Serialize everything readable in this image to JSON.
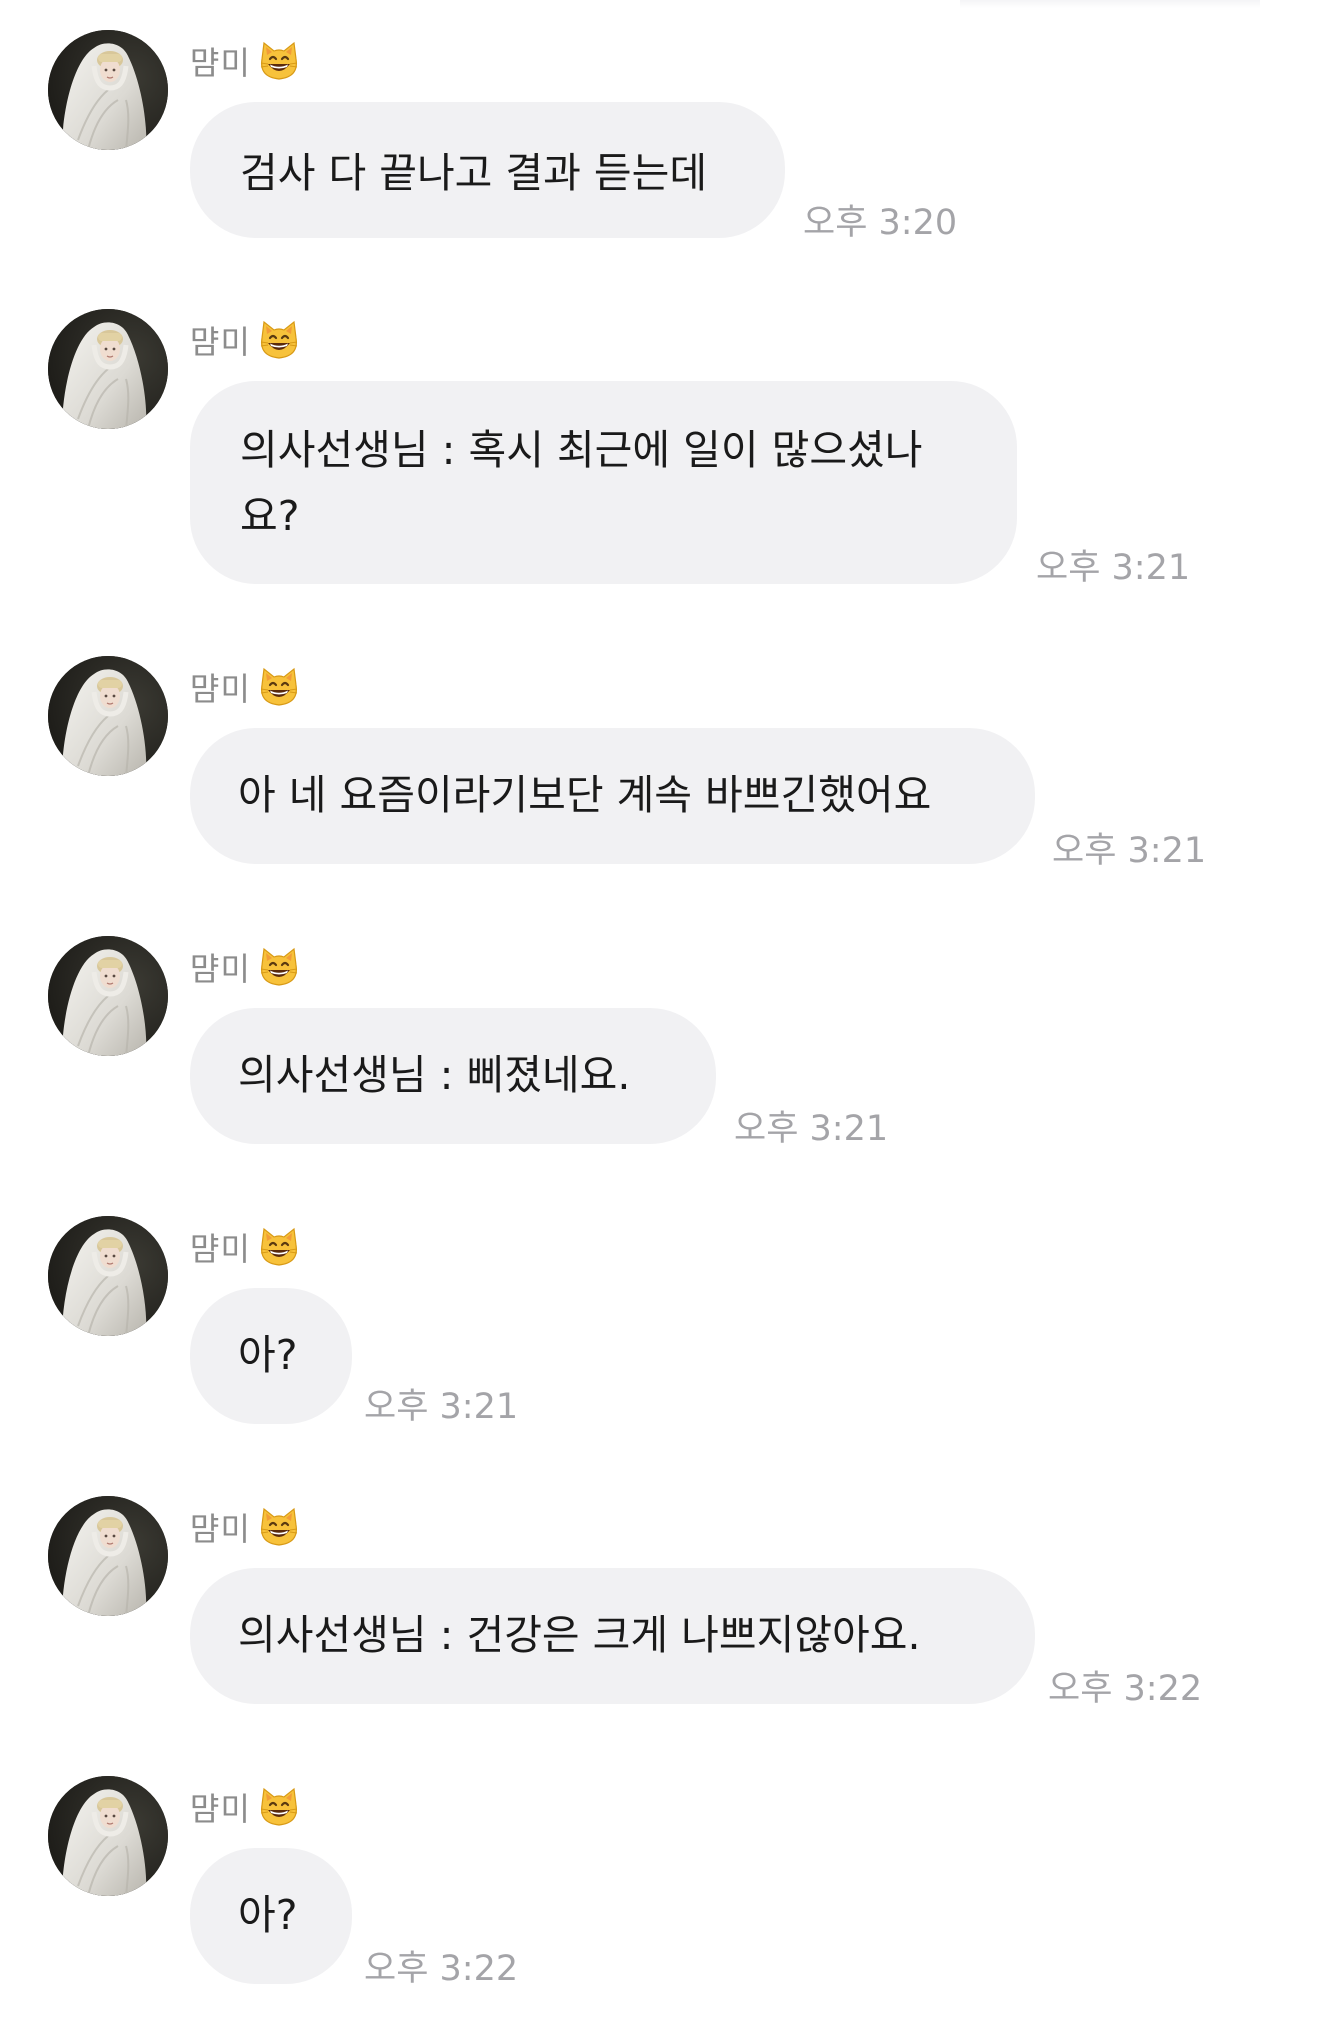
{
  "messages": [
    {
      "sender": "먐미",
      "text": "검사 다 끝나고 결과 듣는데",
      "time": "오후 3:20"
    },
    {
      "sender": "먐미",
      "text": "의사선생님 : 혹시 최근에 일이 많으셨나\n요?",
      "time": "오후 3:21"
    },
    {
      "sender": "먐미",
      "text": "아 네 요즘이라기보단 계속 바쁘긴했어요",
      "time": "오후 3:21"
    },
    {
      "sender": "먐미",
      "text": "의사선생님 : 삐졌네요.",
      "time": "오후 3:21"
    },
    {
      "sender": "먐미",
      "text": "아?",
      "time": "오후 3:21"
    },
    {
      "sender": "먐미",
      "text": "의사선생님 : 건강은 크게 나쁘지않아요.",
      "time": "오후 3:22"
    },
    {
      "sender": "먐미",
      "text": "아?",
      "time": "오후 3:22"
    }
  ],
  "icons": {
    "sender_badge": "grinning-cat-icon",
    "avatar": "profile-avatar"
  },
  "colors": {
    "bubble": "#f1f1f3",
    "text": "#1a1a1a",
    "time": "#a4a4a8",
    "sender": "#8c8c8c"
  }
}
